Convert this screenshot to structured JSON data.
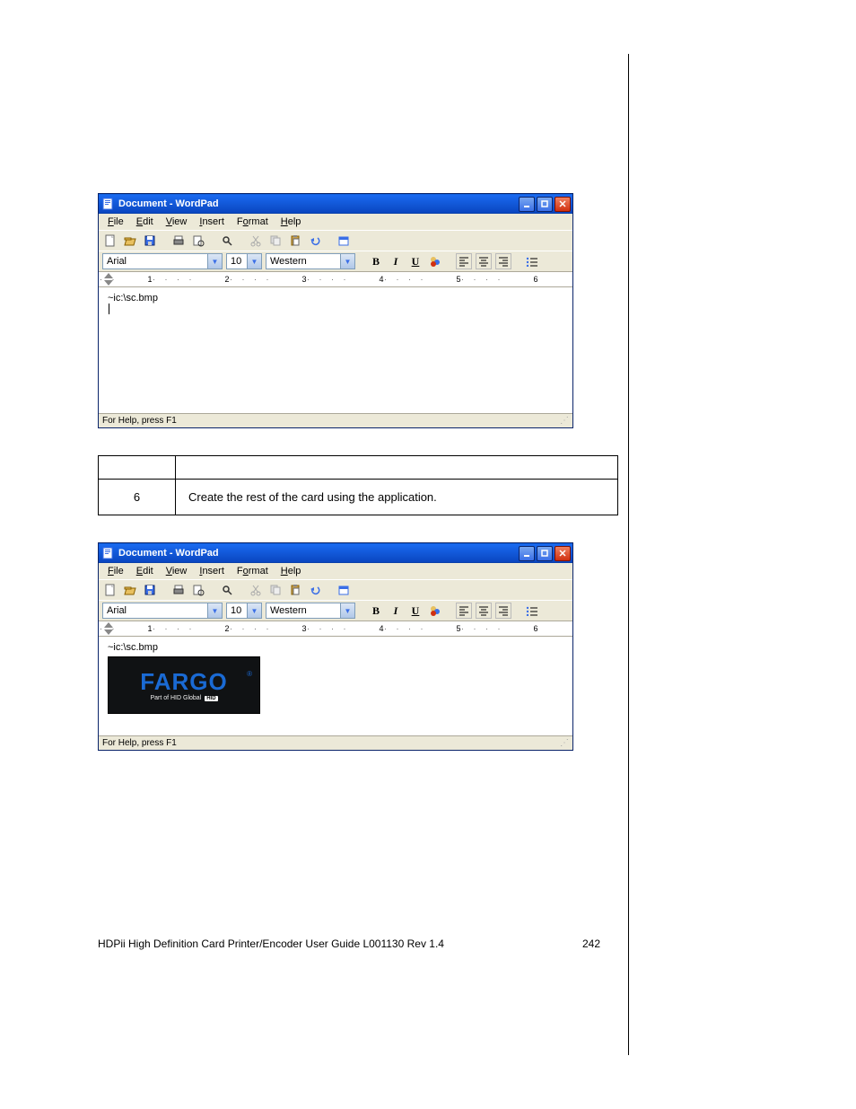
{
  "wordpad": {
    "title": "Document - WordPad",
    "menu": {
      "file": "File",
      "edit": "Edit",
      "view": "View",
      "insert": "Insert",
      "format": "Format",
      "help": "Help"
    },
    "font": "Arial",
    "font_size": "10",
    "charset": "Western",
    "status": "For Help, press F1",
    "ruler_ticks": [
      "1",
      "2",
      "3",
      "4",
      "5",
      "6"
    ],
    "doc_text": "~ic:\\sc.bmp"
  },
  "instruction": {
    "step": "6",
    "text": "Create the rest of the card using the application."
  },
  "fargo": {
    "logo": "FARGO",
    "sub_prefix": "Part of HID Global",
    "sub_badge": "HID"
  },
  "footer": {
    "left": "HDPii High Definition Card Printer/Encoder User Guide    L001130 Rev 1.4",
    "page": "242"
  }
}
